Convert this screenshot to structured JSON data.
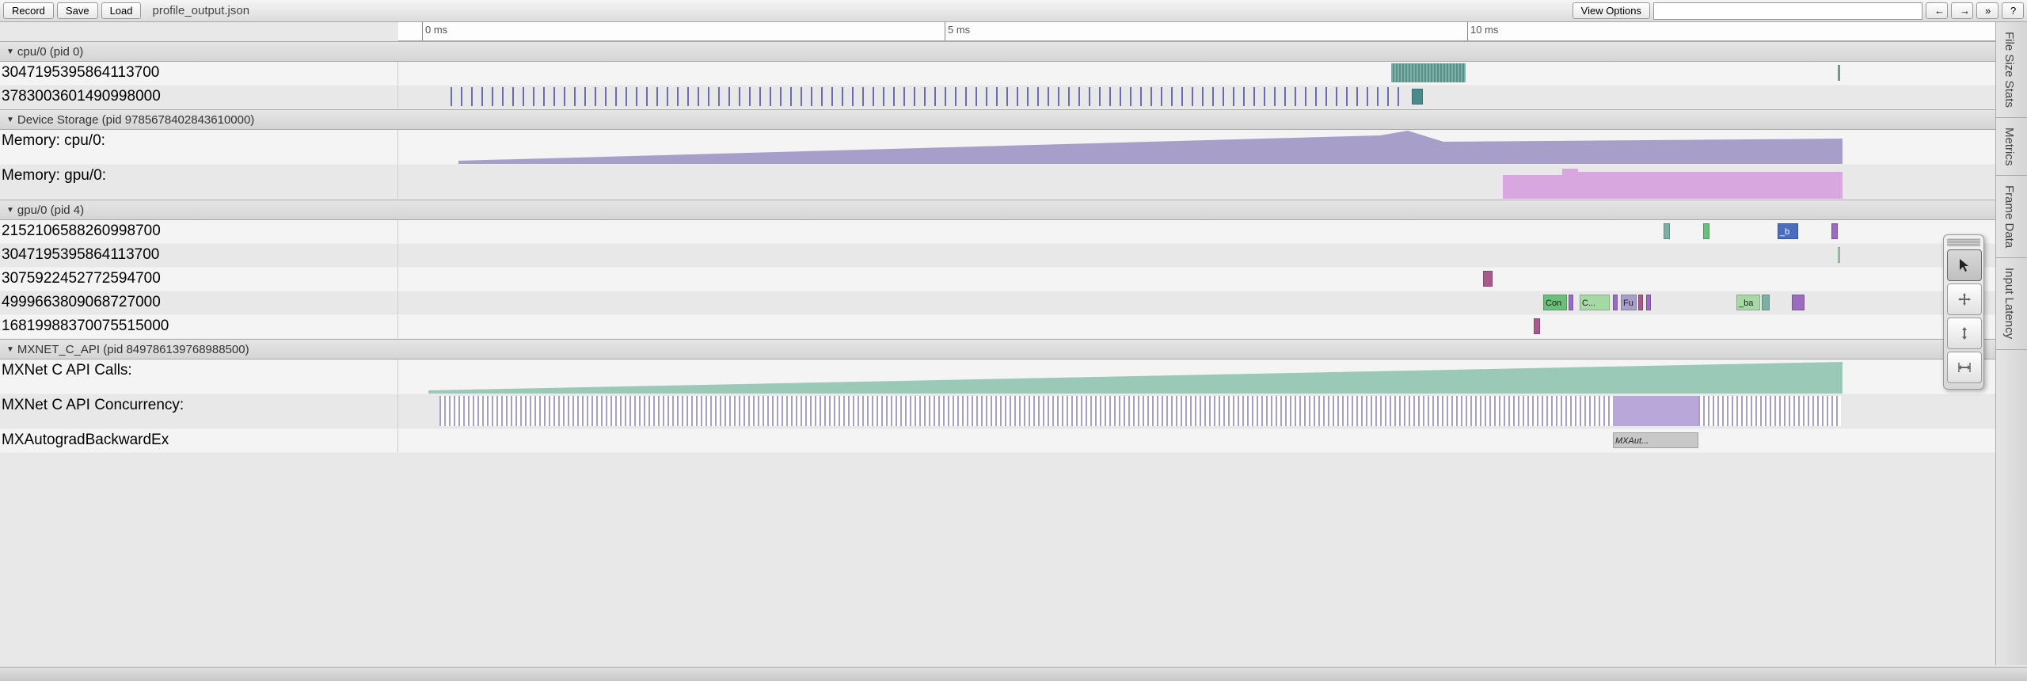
{
  "toolbar": {
    "record": "Record",
    "save": "Save",
    "load": "Load",
    "filename": "profile_output.json",
    "view_options": "View Options",
    "search_placeholder": "",
    "nav_prev": "←",
    "nav_next": "→",
    "nav_more": "»",
    "help": "?"
  },
  "ruler": {
    "ticks": [
      "0 ms",
      "5 ms",
      "10 ms"
    ]
  },
  "sidebar_tabs": [
    "File Size Stats",
    "Metrics",
    "Frame Data",
    "Input Latency"
  ],
  "toolbox": {
    "pointer": "pointer-tool",
    "pan": "pan-tool",
    "zoom_v": "zoom-vertical-tool",
    "zoom_h": "zoom-horizontal-tool"
  },
  "groups": [
    {
      "name": "cpu/0 (pid 0)",
      "tracks": [
        {
          "label": "3047195395864113700",
          "kind": "cpu0_threadA"
        },
        {
          "label": "3783003601490998000",
          "kind": "cpu0_threadB"
        }
      ]
    },
    {
      "name": "Device Storage (pid 9785678402843610000)",
      "tracks": [
        {
          "label": "Memory: cpu/0:",
          "kind": "mem_cpu",
          "tall": true
        },
        {
          "label": "Memory: gpu/0:",
          "kind": "mem_gpu",
          "tall": true
        }
      ]
    },
    {
      "name": "gpu/0 (pid 4)",
      "tracks": [
        {
          "label": "2152106588260998700",
          "kind": "gpu_t0"
        },
        {
          "label": "3047195395864113700",
          "kind": "gpu_t1"
        },
        {
          "label": "3075922452772594700",
          "kind": "gpu_t2"
        },
        {
          "label": "4999663809068727000",
          "kind": "gpu_t3"
        },
        {
          "label": "16819988370075515000",
          "kind": "gpu_t4"
        }
      ]
    },
    {
      "name": "MXNET_C_API (pid 849786139768988500)",
      "tracks": [
        {
          "label": "MXNet C API Calls:",
          "kind": "api_calls",
          "tall": true
        },
        {
          "label": "MXNet C API Concurrency:",
          "kind": "api_conc",
          "tall": true
        },
        {
          "label": "MXAutogradBackwardEx",
          "kind": "api_backward"
        }
      ]
    }
  ],
  "event_labels": {
    "con": "Con",
    "c": "C...",
    "fu": "Fu",
    "ba": "_ba",
    "b": "_b",
    "mxaut": "MXAut..."
  },
  "colors": {
    "teal": "#7bb0a6",
    "indigo": "#6b6bb5",
    "lavender": "#a79fc9",
    "pink": "#d9a7e0",
    "plum": "#a85a8a",
    "green": "#6bbf7a",
    "ltgreen": "#a7d9a7",
    "blue": "#4b6bbf",
    "purple": "#9b6bbf",
    "mint": "#9ac9b8"
  }
}
